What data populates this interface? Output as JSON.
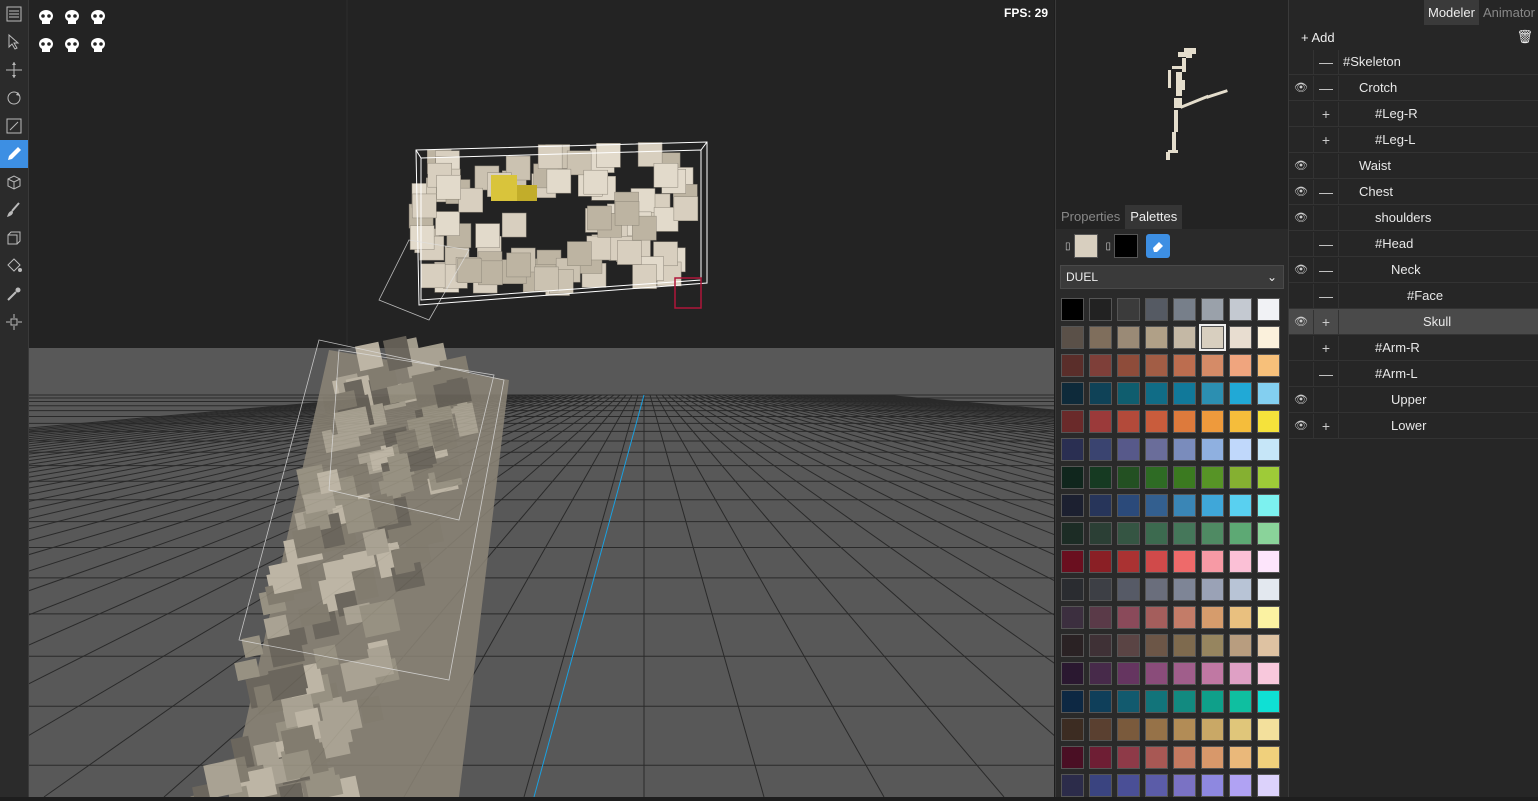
{
  "toolbar": {
    "tools": [
      {
        "name": "select-icon",
        "active": false
      },
      {
        "name": "move-icon",
        "active": false
      },
      {
        "name": "rotate-icon",
        "active": false
      },
      {
        "name": "scale-icon",
        "active": false
      },
      {
        "name": "pencil-icon",
        "active": true
      },
      {
        "name": "cube-icon",
        "active": false
      },
      {
        "name": "brush-icon",
        "active": false
      },
      {
        "name": "extrude-icon",
        "active": false
      },
      {
        "name": "fill-icon",
        "active": false
      },
      {
        "name": "eyedropper-icon",
        "active": false
      },
      {
        "name": "transform-icon",
        "active": false
      }
    ]
  },
  "viewport": {
    "fps_text": "FPS: 29"
  },
  "panel": {
    "tabs": [
      {
        "label": "Properties",
        "active": false
      },
      {
        "label": "Palettes",
        "active": true
      }
    ],
    "primary_color": "#d8cfbf",
    "secondary_color": "#000000",
    "palette_name": "DUEL",
    "swatches": [
      [
        "#000000",
        "#222222",
        "#3b3b3b",
        "#555a63",
        "#777f8a",
        "#9aa1aa",
        "#c4c9d1",
        "#f1f2f5"
      ],
      [
        "#5a5048",
        "#7f6e5c",
        "#9a8a76",
        "#b0a087",
        "#c4b8a5",
        "#d8cfbf",
        "#e8ddd0",
        "#fbf1dc"
      ],
      [
        "#5a2e2a",
        "#7e3f39",
        "#8e4c3a",
        "#a25d45",
        "#bc6d4f",
        "#d58b67",
        "#f0a57e",
        "#f7c07a"
      ],
      [
        "#0e2a3a",
        "#0f4257",
        "#0f5d6e",
        "#106c86",
        "#11799a",
        "#2c8fb1",
        "#21a9d6",
        "#83cff0"
      ],
      [
        "#6a2a2a",
        "#9b3a3a",
        "#b34a3a",
        "#c95c3c",
        "#dd7a3c",
        "#ee9a3c",
        "#f5bd3b",
        "#f5e23b"
      ],
      [
        "#2a2f52",
        "#3a4470",
        "#57598a",
        "#6a6d9a",
        "#7a8cbc",
        "#8fb0e0",
        "#c0d8fb",
        "#c6e6f8"
      ],
      [
        "#10261d",
        "#163a22",
        "#235022",
        "#2e6b24",
        "#3b7a20",
        "#579426",
        "#85b031",
        "#9ecb38"
      ],
      [
        "#1c2030",
        "#27355a",
        "#2b4a7a",
        "#335f8f",
        "#3a86b6",
        "#3fa7d9",
        "#59d0f0",
        "#7cf1ef"
      ],
      [
        "#1c2c25",
        "#2b3f35",
        "#355543",
        "#3c6a4f",
        "#45775a",
        "#4f8a63",
        "#5da974",
        "#8ad39a"
      ],
      [
        "#6a0f1f",
        "#8a1f25",
        "#aa3232",
        "#d04a4a",
        "#ee6a6a",
        "#f79aa5",
        "#fbc0d6",
        "#fde5fb"
      ],
      [
        "#2a2c30",
        "#3d3f45",
        "#565a66",
        "#6a6e7c",
        "#7e8596",
        "#9aa2b6",
        "#b8c4d6",
        "#e3e8ef"
      ],
      [
        "#3c2f3f",
        "#5a3a48",
        "#8a4a5a",
        "#a45e5c",
        "#c37c68",
        "#d69c6c",
        "#e9c07f",
        "#fbf2a2"
      ],
      [
        "#2a2224",
        "#3f3136",
        "#5a4444",
        "#6c5647",
        "#7e6a4e",
        "#96855f",
        "#b89d7f",
        "#dec2a2"
      ],
      [
        "#2a1830",
        "#472a4a",
        "#653560",
        "#8a4c7a",
        "#a05e8b",
        "#c078a3",
        "#dfa0c5",
        "#f8c8dc"
      ],
      [
        "#0d2843",
        "#0f3f5a",
        "#125a6e",
        "#12747a",
        "#128a80",
        "#0fa08a",
        "#0fbfa0",
        "#0fe0d4"
      ],
      [
        "#3c2c22",
        "#5a4030",
        "#7a5a3c",
        "#967248",
        "#b28c56",
        "#c9a866",
        "#e0c67a",
        "#f3e09c"
      ],
      [
        "#4a0f24",
        "#6e1e34",
        "#8e3a48",
        "#a85854",
        "#c47a60",
        "#d8986a",
        "#eab87a",
        "#f0d07c"
      ],
      [
        "#2c2c4a",
        "#3a4480",
        "#4a4f96",
        "#5b5ca8",
        "#7a72c4",
        "#8e88e0",
        "#b0a2f3",
        "#dcd2fb"
      ]
    ]
  },
  "tree": {
    "modes": [
      {
        "label": "Modeler",
        "active": true
      },
      {
        "label": "Animator",
        "active": false
      }
    ],
    "add_label": "Add",
    "rows": [
      {
        "label": "#Skeleton",
        "indent": 0,
        "eye": false,
        "exp": "—",
        "sel": false
      },
      {
        "label": "Crotch",
        "indent": 1,
        "eye": true,
        "exp": "—",
        "sel": false
      },
      {
        "label": "#Leg-R",
        "indent": 2,
        "eye": false,
        "exp": "+",
        "sel": false
      },
      {
        "label": "#Leg-L",
        "indent": 2,
        "eye": false,
        "exp": "+",
        "sel": false
      },
      {
        "label": "Waist",
        "indent": 1,
        "eye": true,
        "exp": "",
        "sel": false
      },
      {
        "label": "Chest",
        "indent": 1,
        "eye": true,
        "exp": "—",
        "sel": false
      },
      {
        "label": "shoulders",
        "indent": 2,
        "eye": true,
        "exp": "",
        "sel": false
      },
      {
        "label": "#Head",
        "indent": 2,
        "eye": false,
        "exp": "—",
        "sel": false
      },
      {
        "label": "Neck",
        "indent": 3,
        "eye": true,
        "exp": "—",
        "sel": false
      },
      {
        "label": "#Face",
        "indent": 4,
        "eye": false,
        "exp": "—",
        "sel": false
      },
      {
        "label": "Skull",
        "indent": 5,
        "eye": true,
        "exp": "+",
        "sel": true
      },
      {
        "label": "#Arm-R",
        "indent": 2,
        "eye": false,
        "exp": "+",
        "sel": false
      },
      {
        "label": "#Arm-L",
        "indent": 2,
        "eye": false,
        "exp": "—",
        "sel": false
      },
      {
        "label": "Upper",
        "indent": 3,
        "eye": true,
        "exp": "",
        "sel": false
      },
      {
        "label": "Lower",
        "indent": 3,
        "eye": true,
        "exp": "+",
        "sel": false
      }
    ]
  }
}
